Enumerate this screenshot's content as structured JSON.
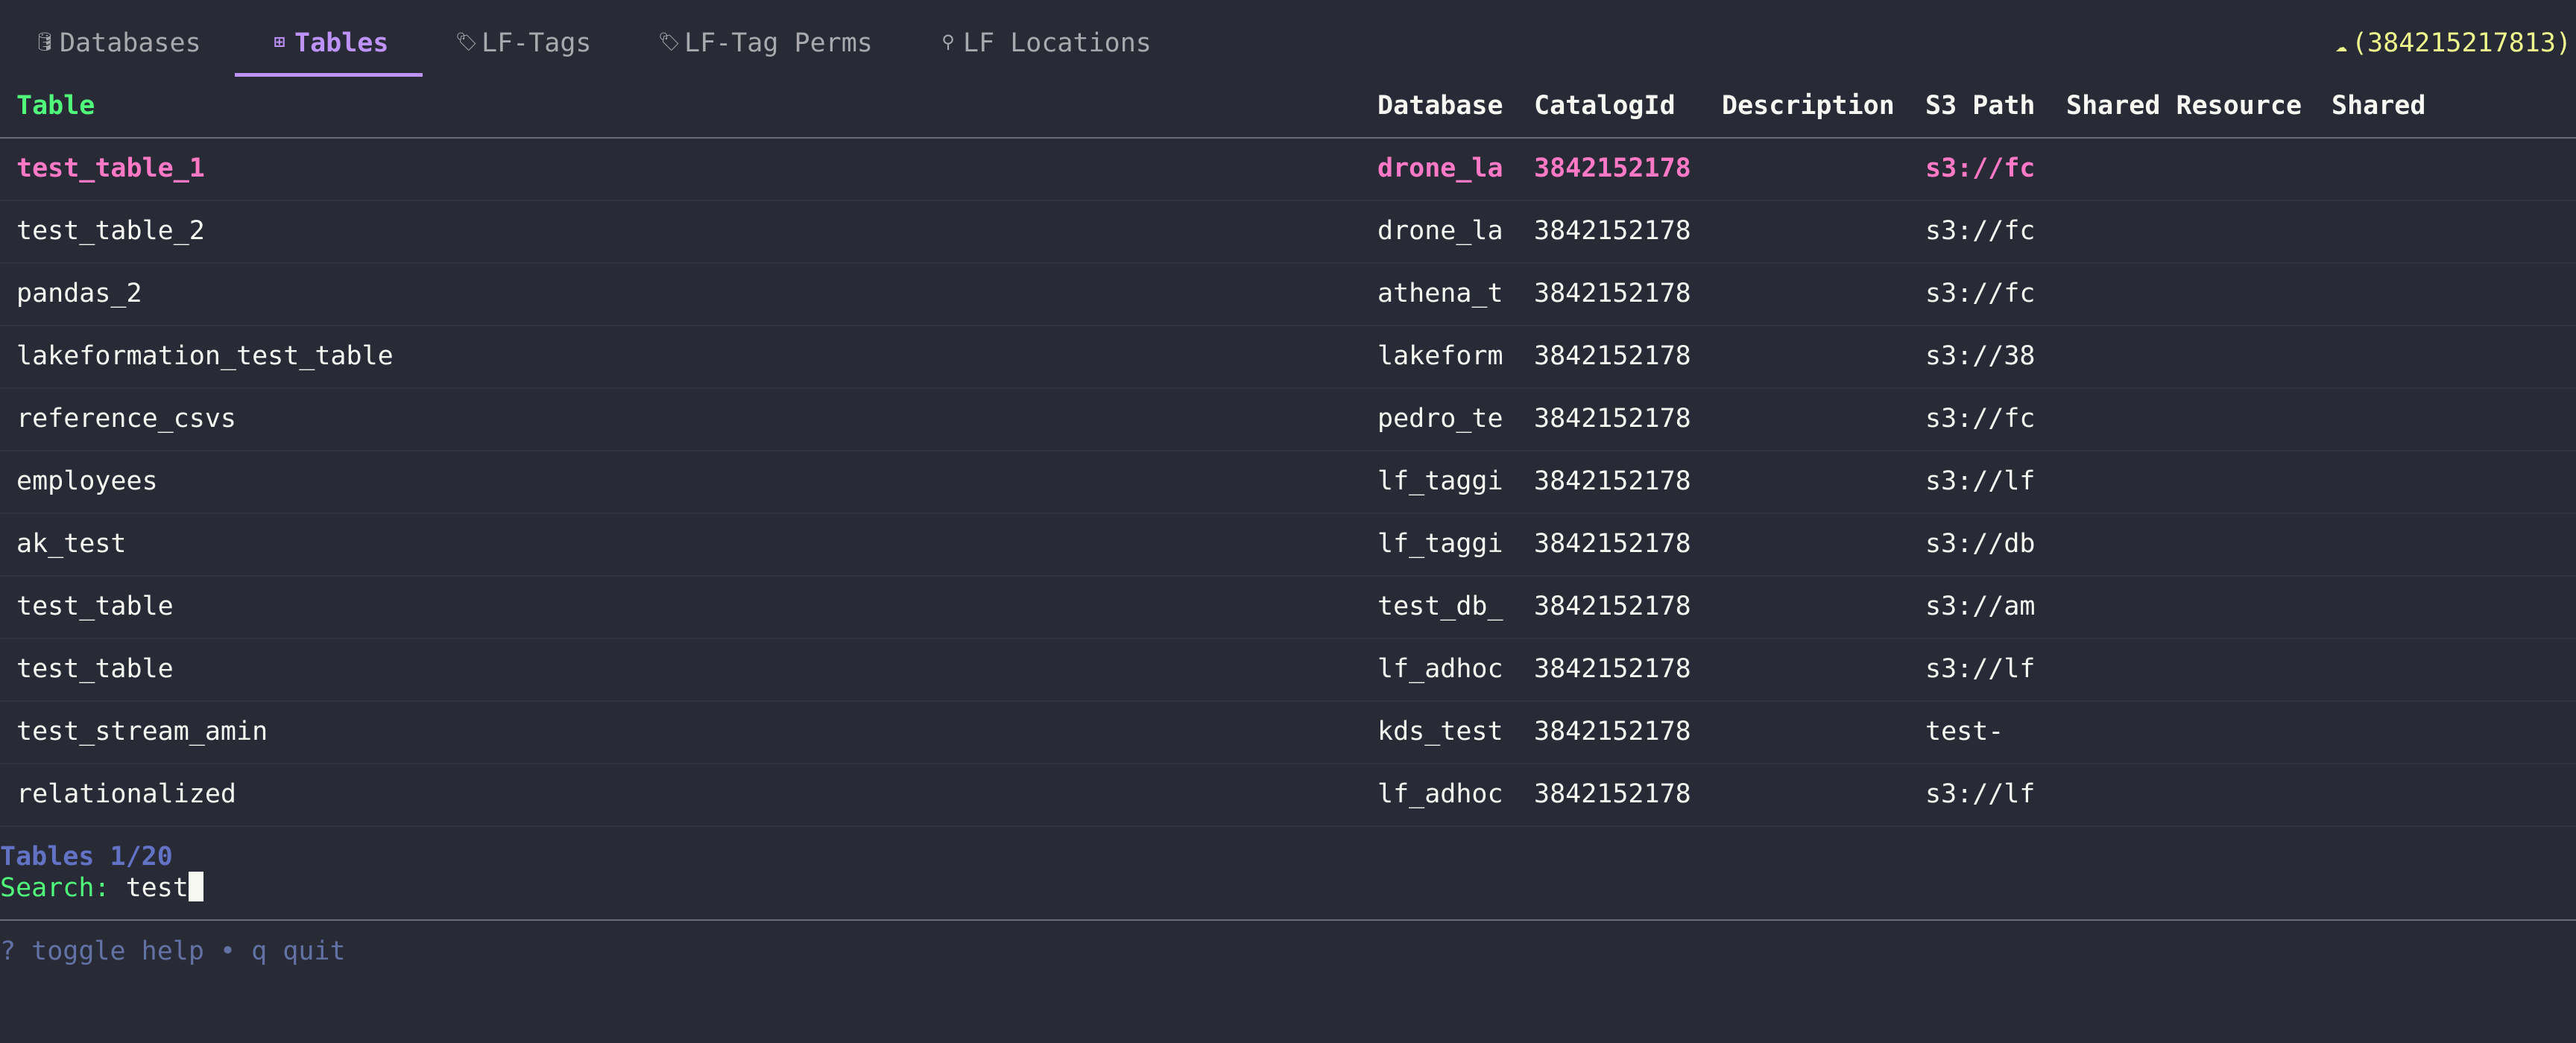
{
  "tabs": [
    {
      "icon": "database-icon",
      "glyph": "🛢",
      "label": "Databases"
    },
    {
      "icon": "table-icon",
      "glyph": "⊞",
      "label": "Tables"
    },
    {
      "icon": "tag-icon",
      "glyph": "🏷",
      "label": "LF-Tags"
    },
    {
      "icon": "tags-icon",
      "glyph": "🏷",
      "label": "LF-Tag Perms"
    },
    {
      "icon": "location-pin-icon",
      "glyph": "⚲",
      "label": "LF Locations"
    }
  ],
  "active_tab": "Tables",
  "account": {
    "icon": "cloud-icon",
    "glyph": "☁",
    "text": "(384215217813)"
  },
  "table": {
    "columns": [
      "Table",
      "Database",
      "CatalogId",
      "Description",
      "S3 Path",
      "Shared Resource",
      "Shared"
    ],
    "rows": [
      [
        "test_table_1",
        "drone_la",
        "3842152178",
        "",
        "s3://fc",
        "",
        ""
      ],
      [
        "test_table_2",
        "drone_la",
        "3842152178",
        "",
        "s3://fc",
        "",
        ""
      ],
      [
        "pandas_2",
        "athena_t",
        "3842152178",
        "",
        "s3://fc",
        "",
        ""
      ],
      [
        "lakeformation_test_table",
        "lakeform",
        "3842152178",
        "",
        "s3://38",
        "",
        ""
      ],
      [
        "reference_csvs",
        "pedro_te",
        "3842152178",
        "",
        "s3://fc",
        "",
        ""
      ],
      [
        "employees",
        "lf_taggi",
        "3842152178",
        "",
        "s3://lf",
        "",
        ""
      ],
      [
        "ak_test",
        "lf_taggi",
        "3842152178",
        "",
        "s3://db",
        "",
        ""
      ],
      [
        "test_table",
        "test_db_",
        "3842152178",
        "",
        "s3://am",
        "",
        ""
      ],
      [
        "test_table",
        "lf_adhoc",
        "3842152178",
        "",
        "s3://lf",
        "",
        ""
      ],
      [
        "test_stream_amin",
        "kds_test",
        "3842152178",
        "",
        "test-",
        "",
        ""
      ],
      [
        "relationalized",
        "lf_adhoc",
        "3842152178",
        "",
        "s3://lf",
        "",
        ""
      ]
    ],
    "selected_row": 0
  },
  "status": "Tables 1/20",
  "search": {
    "label": "Search:",
    "value": "test"
  },
  "help": "? toggle help • q quit",
  "colors": {
    "background": "#282a36",
    "accent": "#bd93f9",
    "header": "#50fa7b",
    "selected": "#ff79c6",
    "account": "#f1fa8c",
    "muted": "#6272a4"
  }
}
